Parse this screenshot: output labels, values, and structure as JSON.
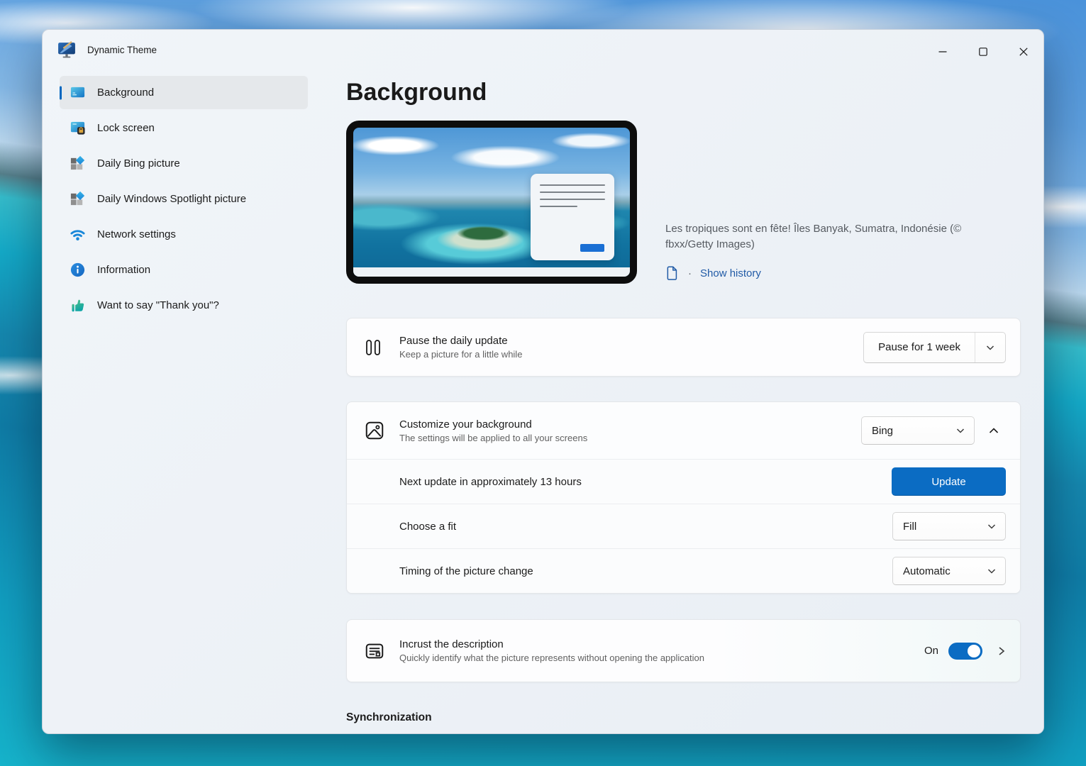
{
  "window": {
    "title": "Dynamic Theme",
    "controls": {
      "minimize_icon": "minimize",
      "maximize_icon": "maximize",
      "close_icon": "close"
    }
  },
  "sidebar": {
    "items": [
      {
        "label": "Background",
        "icon": "background-picture-icon",
        "selected": true
      },
      {
        "label": "Lock screen",
        "icon": "lock-screen-icon",
        "selected": false
      },
      {
        "label": "Daily Bing picture",
        "icon": "bing-picture-icon",
        "selected": false
      },
      {
        "label": "Daily Windows Spotlight picture",
        "icon": "spotlight-picture-icon",
        "selected": false
      },
      {
        "label": "Network settings",
        "icon": "wifi-icon",
        "selected": false
      },
      {
        "label": "Information",
        "icon": "info-icon",
        "selected": false
      },
      {
        "label": "Want to say \"Thank you\"?",
        "icon": "thumbs-up-icon",
        "selected": false
      }
    ]
  },
  "main": {
    "page_title": "Background",
    "preview": {
      "caption": "Les tropiques sont en fête! Îles Banyak, Sumatra, Indonésie (© fbxx/Getty Images)",
      "separator": "·",
      "history_link": "Show history"
    },
    "pause_card": {
      "title": "Pause the daily update",
      "subtitle": "Keep a picture for a little while",
      "button_label": "Pause for 1 week"
    },
    "customize_card": {
      "title": "Customize your background",
      "subtitle": "The settings will be applied to all your screens",
      "source_value": "Bing",
      "rows": [
        {
          "label": "Next update in approximately 13 hours",
          "control": "Update"
        },
        {
          "label": "Choose a fit",
          "control": "Fill"
        },
        {
          "label": "Timing of the picture change",
          "control": "Automatic"
        }
      ]
    },
    "incrust_card": {
      "title": "Incrust the description",
      "subtitle": "Quickly identify what the picture represents without opening the application",
      "toggle_state": "On"
    },
    "sync_section": {
      "title": "Synchronization"
    }
  },
  "colors": {
    "accent_blue": "#0b6cc3",
    "sidebar_accent": "#0067c0",
    "link_blue": "#215ba6",
    "window_bg": "#eff3f7"
  }
}
